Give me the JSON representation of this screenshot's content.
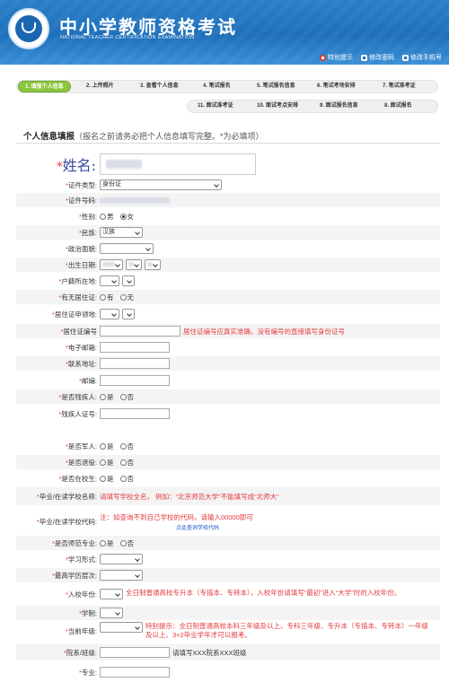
{
  "header": {
    "title_cn": "中小学教师资格考试",
    "title_en": "NATIONAL TEACHER CERTIFICATION EXAMINATION",
    "links": [
      "特别提示",
      "修改密码",
      "修改手机号"
    ]
  },
  "steps_row1": [
    "1. 填报个人信息",
    "2. 上传照片",
    "3. 查看个人信息",
    "4. 笔试报名",
    "5. 笔试报名信息",
    "6. 笔试考场安排",
    "7. 笔试准考证"
  ],
  "steps_row2": [
    "11. 面试准考证",
    "10. 面试考点安排",
    "9. 面试报名信息",
    "8. 面试报名"
  ],
  "section": {
    "title": "个人信息填报",
    "note": "（报名之前请务必把个人信息填写完整。*为必填项）"
  },
  "form": {
    "name_label": "姓名:",
    "req": "*",
    "id_type_label": "证件类型:",
    "id_type_value": "身份证",
    "id_no_label": "证件号码:",
    "gender_label": "性别:",
    "gender_options": [
      "男",
      "女"
    ],
    "ethnic_label": "民族:",
    "ethnic_value": "汉族",
    "political_label": "政治面貌:",
    "birth_label": "出生日期:",
    "hukou_label": "户籍所在地:",
    "residence_permit_label": "有无居住证:",
    "yes_no_1": [
      "有",
      "无"
    ],
    "residence_place_label": "居住证申领地:",
    "residence_no_label": "居住证编号",
    "residence_no_hint": "居住证编号应真实准确，没有编号的直接填写身份证号",
    "email_label": "电子邮箱:",
    "address_label": "联系地址:",
    "postcode_label": "邮编:",
    "disabled_label": "是否残疾人:",
    "yes_no": [
      "是",
      "否"
    ],
    "disabled_no_label": "残疾人证号:",
    "military_label": "是否军人:",
    "retired_label": "是否退役:",
    "student_label": "是否在校生:",
    "school_name_label": "毕业/在读学校名称:",
    "school_name_hint": "请填写学校全名，  例如：“北京师范大学”不能填写成“北师大”",
    "school_code_label": "毕业/在读学校代码:",
    "school_code_hint": "注：如查询不到自己学校的代码，请输入00000即可",
    "school_code_link": "点此查询学校代码",
    "normal_major_label": "是否师范专业:",
    "study_form_label": "学习形式:",
    "edu_label": "最高学历层次:",
    "enroll_year_label": "入校年份:",
    "enroll_year_hint": "全日制普通高校专升本（专插本、专转本），入校年份请填写“最初”进入“大学”时的入校年份。",
    "system_label": "学制:",
    "grade_label": "当前年级:",
    "grade_hint": "特别提示：全日制普通高校本科三年级及以上、专科三年级、专升本（专插本、专转本）一年级及以上、3+2毕业学年才可以报考。",
    "dept_label": "院系/班级:",
    "dept_hint": "请填写XXX院系XXX班级",
    "major_label": "专业:"
  }
}
